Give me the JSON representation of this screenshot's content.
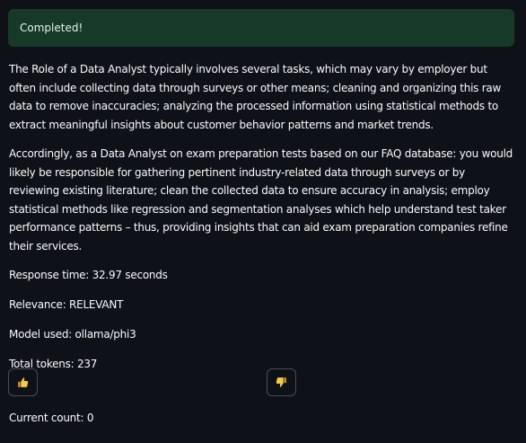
{
  "status": {
    "message": "Completed!",
    "color": "#173928"
  },
  "answer": {
    "paragraphs": [
      "The Role of a Data Analyst typically involves several tasks, which may vary by employer but often include collecting data through surveys or other means; cleaning and organizing this raw data to remove inaccuracies; analyzing the processed information using statistical methods to extract meaningful insights about customer behavior patterns and market trends.",
      "Accordingly, as a Data Analyst on exam preparation tests based on our FAQ database: you would likely be responsible for gathering pertinent industry-related data through surveys or by reviewing existing literature; clean the collected data to ensure accuracy in analysis; employ statistical methods like regression and segmentation analyses which help understand test taker performance patterns – thus, providing insights that can aid exam preparation companies refine their services."
    ]
  },
  "metrics": {
    "response_time": "Response time: 32.97 seconds",
    "relevance": "Relevance: RELEVANT",
    "model": "Model used: ollama/phi3",
    "tokens": "Total tokens: 237"
  },
  "feedback": {
    "thumbs_up_icon": "thumbs-up-icon",
    "thumbs_down_icon": "thumbs-down-icon",
    "icon_color": "#f7c948"
  },
  "counter": {
    "text": "Current count: 0"
  }
}
